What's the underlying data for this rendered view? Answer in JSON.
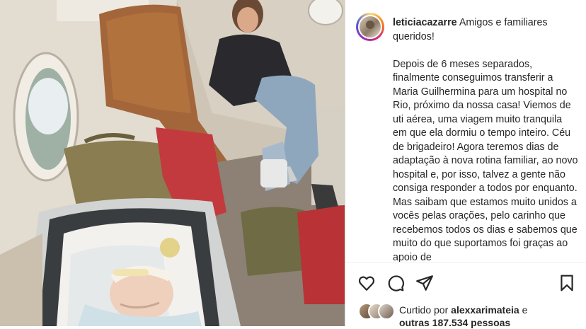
{
  "post": {
    "username": "leticiacazarre",
    "caption_first": "Amigos e familiares queridos!",
    "caption_body": "Depois de 6 meses separados, finalmente conseguimos transferir a Maria Guilhermina para um hospital no Rio, próximo da nossa casa! Viemos de uti aérea, uma viagem muito tranquila em que ela dormiu o tempo inteiro. Céu de brigadeiro! Agora teremos dias de adaptação à nova rotina familiar, ao novo hospital e, por isso, talvez a gente não consiga responder a todos por enquanto. Mas saibam que estamos muito unidos a vocês pelas orações, pelo carinho que recebemos todos os dias e sabemos que muito do que suportamos foi graças ao apoio de"
  },
  "likes": {
    "prefix": "Curtido por",
    "user": "alexxarimateia",
    "middle": "e",
    "others": "outras 187.534 pessoas"
  },
  "icons": {
    "like": "heart-icon",
    "comment": "comment-icon",
    "share": "share-icon",
    "save": "bookmark-icon"
  }
}
